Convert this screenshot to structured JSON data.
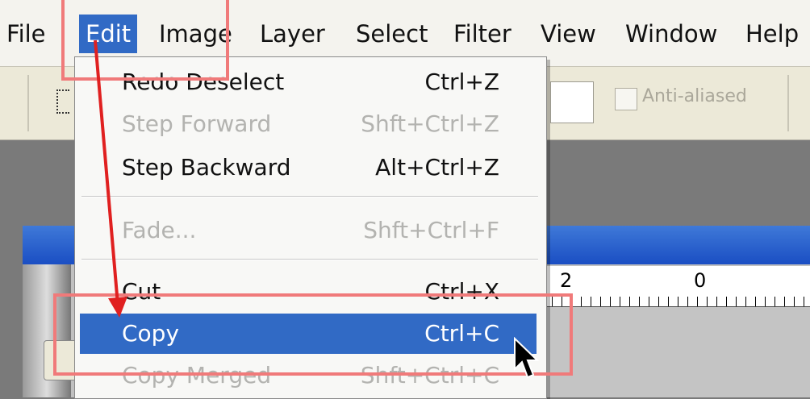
{
  "menubar": {
    "items": [
      "File",
      "Edit",
      "Image",
      "Layer",
      "Select",
      "Filter",
      "View",
      "Window",
      "Help"
    ],
    "active": "Edit"
  },
  "options_bar": {
    "anti_aliased_label": "Anti-aliased",
    "anti_aliased_checked": false
  },
  "ruler": {
    "labels": [
      "2",
      "0"
    ]
  },
  "edit_menu": {
    "items": [
      {
        "label": "Redo Deselect",
        "shortcut": "Ctrl+Z",
        "enabled": true
      },
      {
        "label": "Step Forward",
        "shortcut": "Shft+Ctrl+Z",
        "enabled": false
      },
      {
        "label": "Step Backward",
        "shortcut": "Alt+Ctrl+Z",
        "enabled": true
      },
      {
        "label": "Fade...",
        "shortcut": "Shft+Ctrl+F",
        "enabled": false
      },
      {
        "label": "Cut",
        "shortcut": "Ctrl+X",
        "enabled": true
      },
      {
        "label": "Copy",
        "shortcut": "Ctrl+C",
        "enabled": true,
        "highlighted": true
      },
      {
        "label": "Copy Merged",
        "shortcut": "Shft+Ctrl+C",
        "enabled": false
      }
    ]
  },
  "annotation": {
    "color": "#f07a7a",
    "arrow_color": "#e02020"
  },
  "colors": {
    "highlight": "#316ac5",
    "titlebar": "#1a4ec3"
  }
}
